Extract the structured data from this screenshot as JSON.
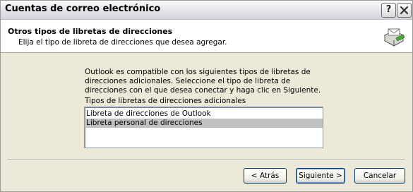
{
  "window": {
    "title": "Cuentas de correo electrónico",
    "help_glyph": "?",
    "close_icon": "close-icon"
  },
  "header": {
    "title": "Otros tipos de libretas de direcciones",
    "subtitle": "Elija el tipo de libreta de direcciones que desea agregar.",
    "icon": "address-book-icon"
  },
  "body": {
    "description": "Outlook es compatible con los siguientes tipos de libretas de direcciones adicionales. Seleccione el tipo de libreta de direcciones con el que desea conectar y haga clic en Siguiente.",
    "list_label": "Tipos de libretas de direcciones adicionales",
    "list_items": [
      "Libreta de direcciones de Outlook",
      "Libreta personal de direcciones"
    ],
    "selected_item": "Libreta personal de direcciones"
  },
  "buttons": {
    "back": "< Atrás",
    "next": "Siguiente >",
    "cancel": "Cancelar"
  }
}
